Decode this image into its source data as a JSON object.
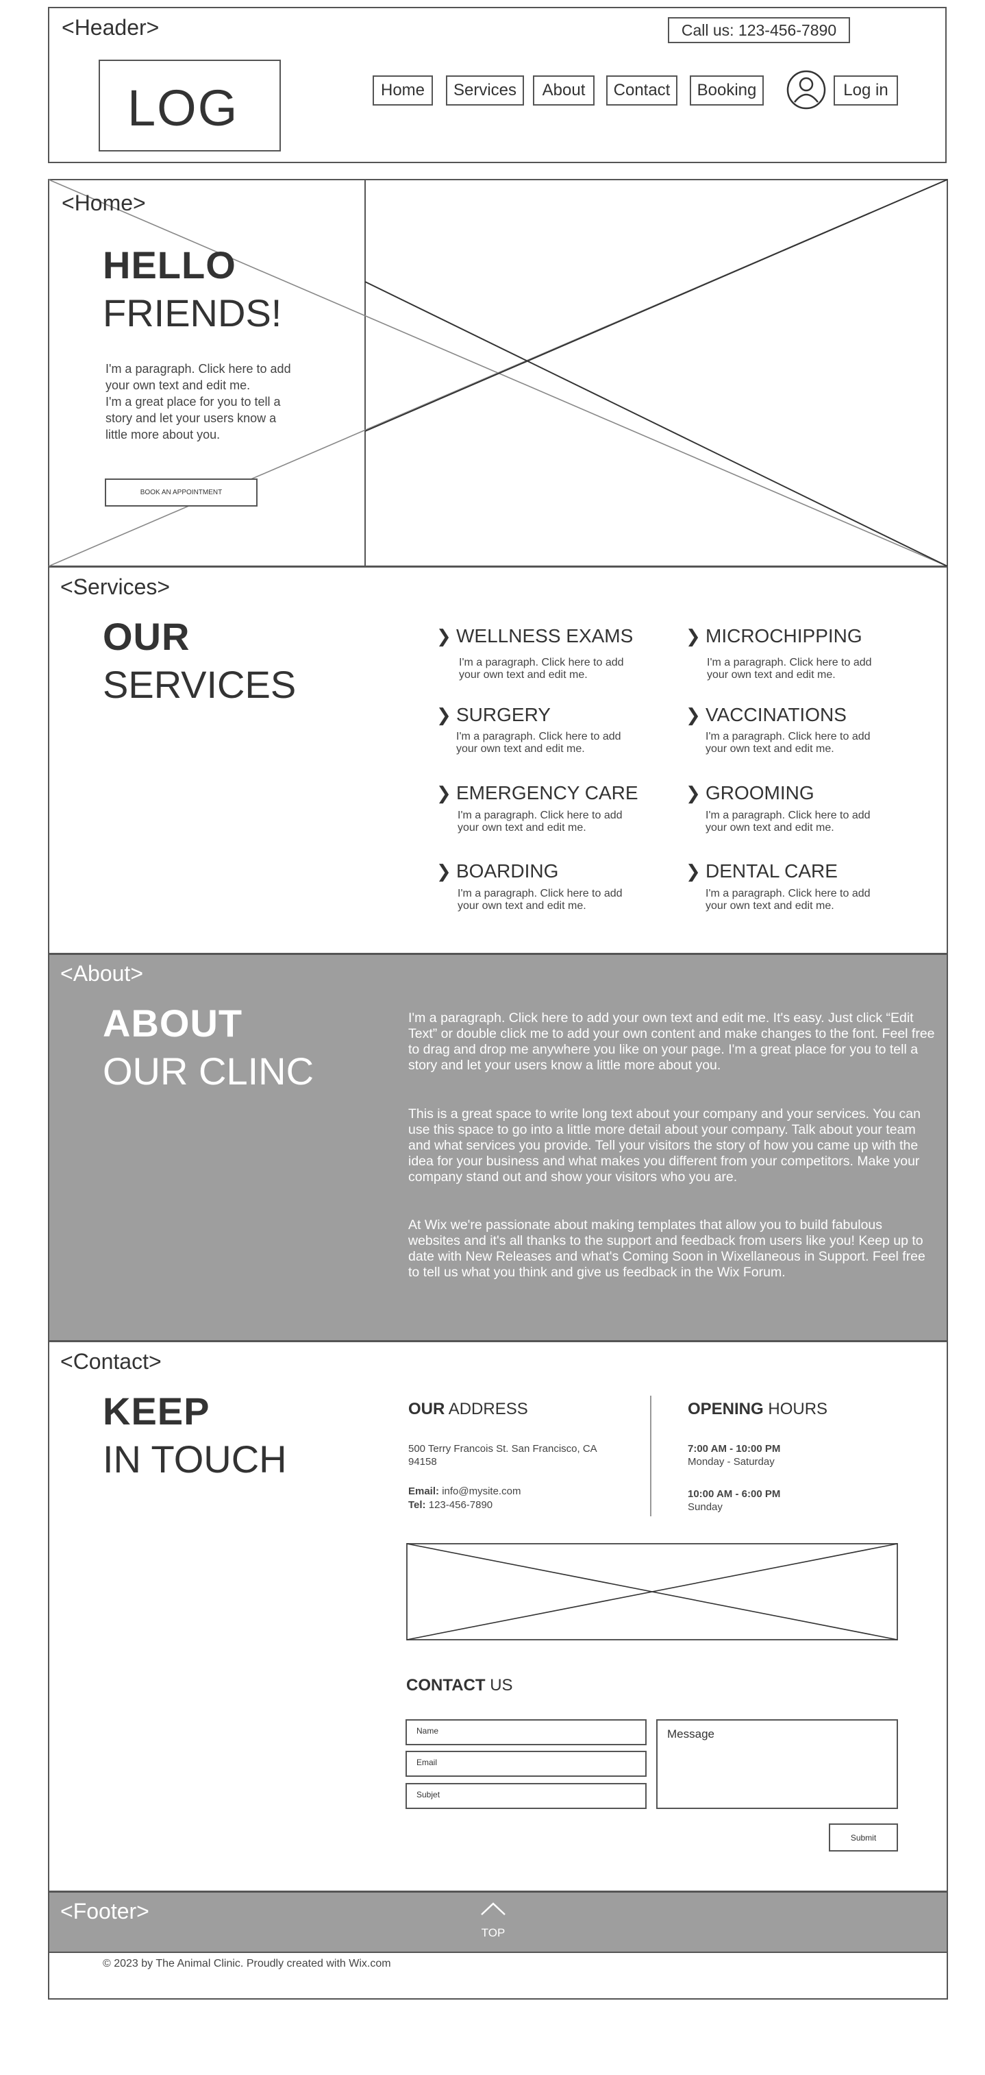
{
  "header": {
    "tag": "<Header>",
    "phone": "Call us: 123-456-7890",
    "logo": "LOG",
    "nav": [
      "Home",
      "Services",
      "About",
      "Contact",
      "Booking"
    ],
    "login": "Log in"
  },
  "home": {
    "tag": "<Home>",
    "title_bold": "HELLO",
    "title_light": "FRIENDS!",
    "paragraph_lines": [
      "I'm a paragraph. Click here to add",
      "your own text and edit me.",
      "I'm a great place for you to tell a",
      "story and let your users know a",
      "little more about you."
    ],
    "cta": "BOOK AN APPOINTMENT"
  },
  "services": {
    "tag": "<Services>",
    "title_bold": "OUR",
    "title_light": "SERVICES",
    "items": [
      {
        "title": "WELLNESS EXAMS",
        "text": "I'm a paragraph. Click here to add your own text and edit me."
      },
      {
        "title": "MICROCHIPPING",
        "text": "I'm a paragraph. Click here to add your own text and edit me."
      },
      {
        "title": "SURGERY",
        "text": "I'm a paragraph. Click here to add your own text and edit me."
      },
      {
        "title": "VACCINATIONS",
        "text": "I'm a paragraph. Click here to add your own text and edit me."
      },
      {
        "title": "EMERGENCY CARE",
        "text": "I'm a paragraph. Click here to add your own text and edit me."
      },
      {
        "title": "GROOMING",
        "text": "I'm a paragraph. Click here to add your own text and edit me."
      },
      {
        "title": "BOARDING",
        "text": "I'm a paragraph. Click here to add your own text and edit me."
      },
      {
        "title": "DENTAL CARE",
        "text": "I'm a paragraph. Click here to add your own text and edit me."
      }
    ]
  },
  "about": {
    "tag": "<About>",
    "title_bold": "ABOUT",
    "title_light": "OUR CLINC",
    "paragraphs": [
      "I'm a paragraph. Click here to add your own text and edit me. It's easy. Just click “Edit Text” or double click me to add your own content and make changes to the font. Feel free to drag and drop me anywhere you like on your page. I'm a great place for you to tell a story and let your users know a little more about you.",
      "This is a great space to write long text about your company and your services. You can use this space to go into a little more detail about your company. Talk about your team and what services you provide. Tell your visitors the story of how you came up with the idea for your business and what makes you different from your competitors. Make your company stand out and show your visitors who you are.",
      "At Wix we're passionate about making templates that allow you to build fabulous websites and it's all thanks to the support and feedback from users like you! Keep up to date with New Releases and what's Coming Soon in Wixellaneous in Support. Feel free to tell us what you think and give us feedback in the Wix Forum."
    ]
  },
  "contact": {
    "tag": "<Contact>",
    "title_bold": "KEEP",
    "title_light": "IN TOUCH",
    "address_heading_bold": "OUR",
    "address_heading_light": "ADDRESS",
    "address_lines": [
      "500 Terry Francois St. San Francisco, CA",
      "94158"
    ],
    "email_label": "Email:",
    "email": "info@mysite.com",
    "tel_label": "Tel:",
    "tel": "123-456-7890",
    "hours_heading_bold": "OPENING",
    "hours_heading_light": "HOURS",
    "hours": [
      {
        "time": "7:00 AM - 10:00 PM",
        "days": "Monday - Saturday"
      },
      {
        "time": "10:00 AM - 6:00 PM",
        "days": "Sunday"
      }
    ],
    "form_heading_bold": "CONTACT",
    "form_heading_light": "US",
    "name_placeholder": "Name",
    "email_placeholder": "Email",
    "subject_placeholder": "Subjet",
    "message_placeholder": "Message",
    "submit": "Submit"
  },
  "footer": {
    "tag": "<Footer>",
    "top": "TOP",
    "copyright": "© 2023 by The Animal Clinic. Proudly created with Wix.com"
  },
  "colors": {
    "gray_band": "#9e9e9e",
    "border": "#555555",
    "text": "#333333"
  }
}
